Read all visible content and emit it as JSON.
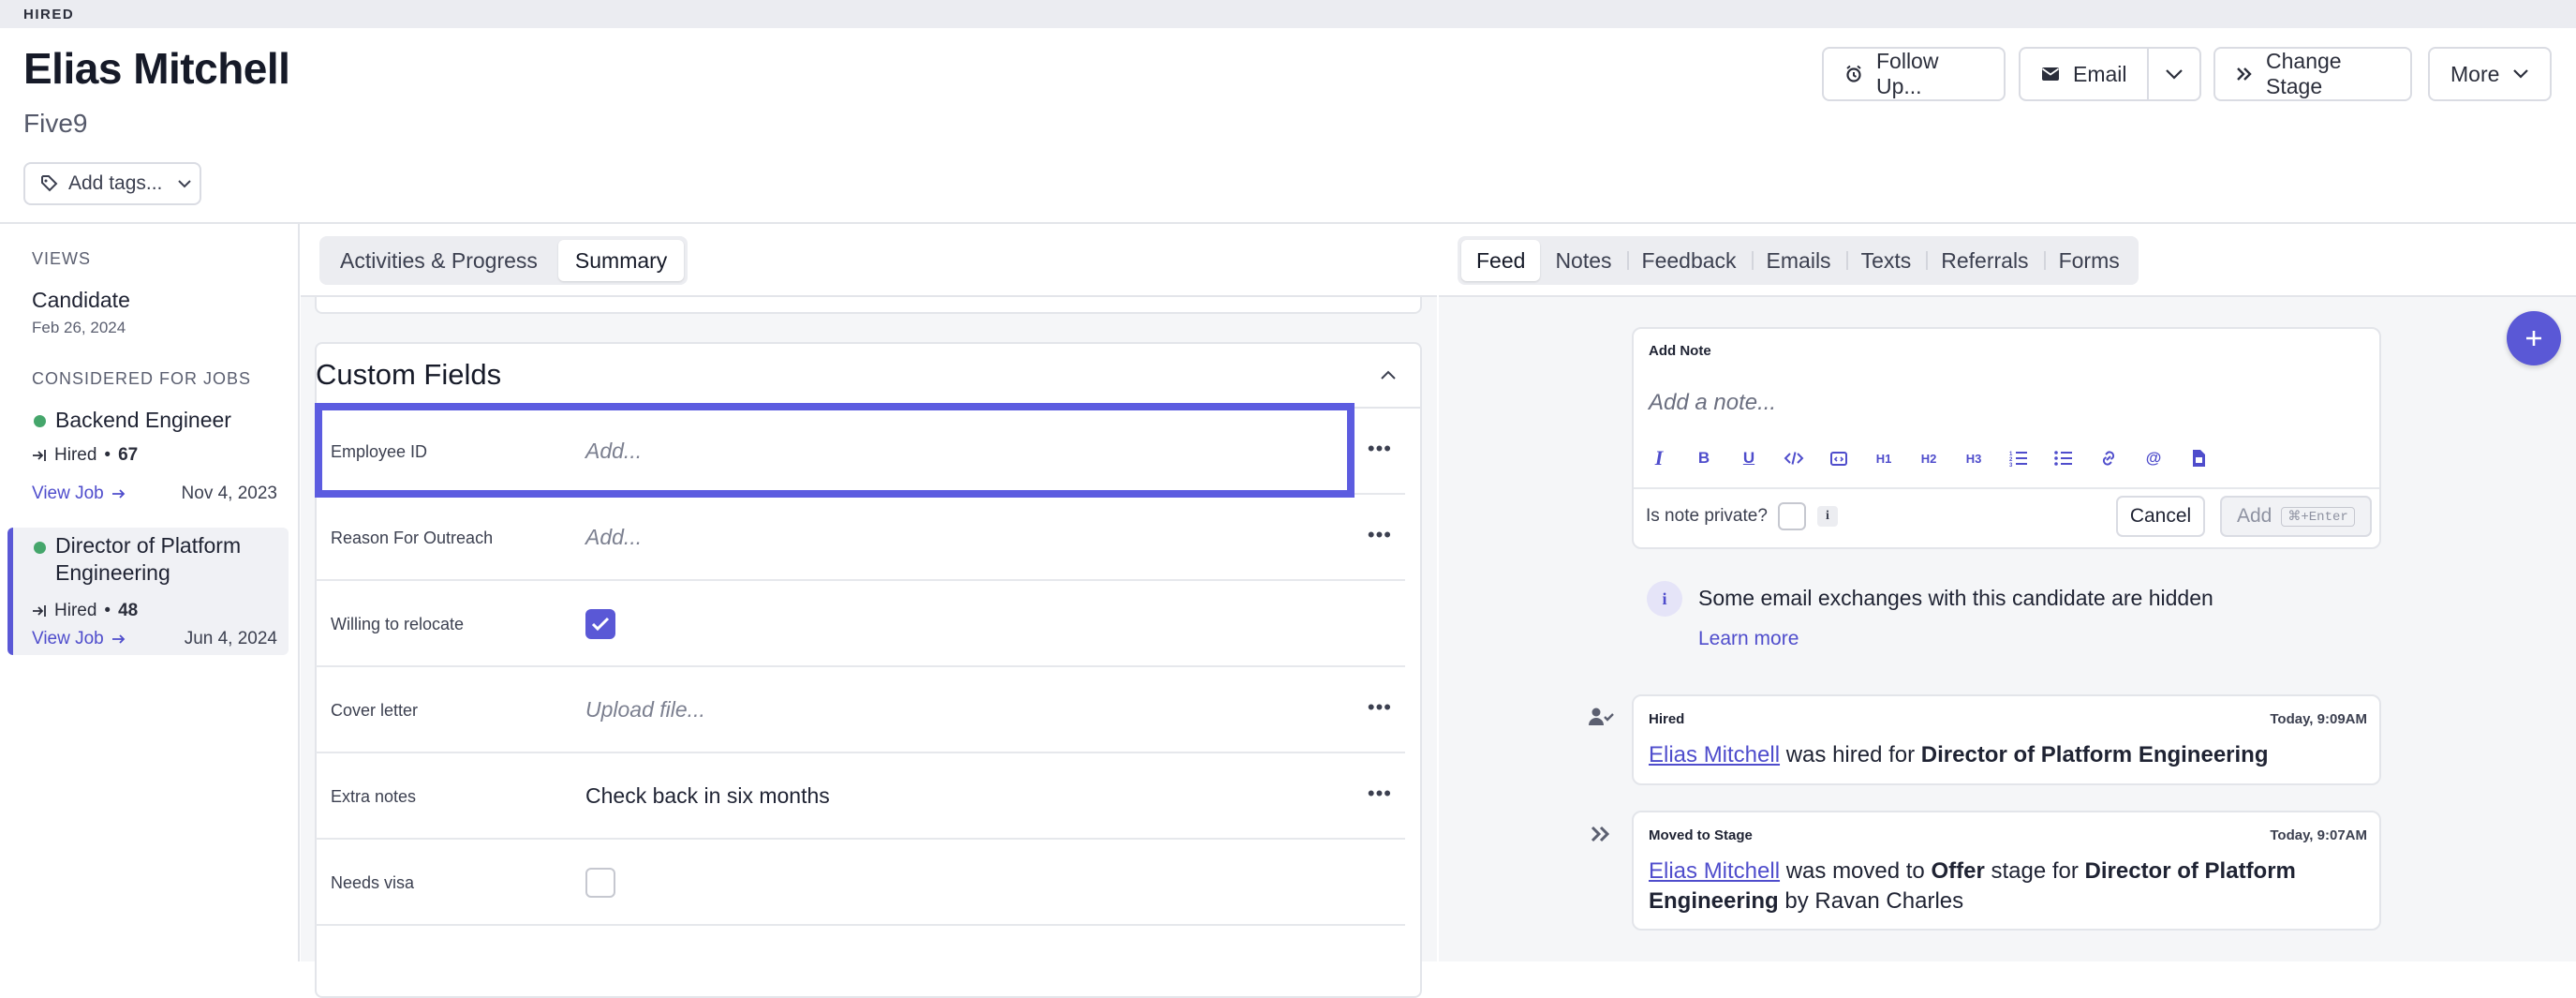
{
  "status_banner": "HIRED",
  "candidate": {
    "name": "Elias Mitchell",
    "company": "Five9"
  },
  "tags": {
    "label": "Add tags..."
  },
  "header_actions": {
    "follow_up": "Follow Up...",
    "email": "Email",
    "change_stage": "Change Stage",
    "more": "More"
  },
  "sidebar": {
    "views_label": "VIEWS",
    "view_title": "Candidate",
    "view_date": "Feb 26, 2024",
    "jobs_label": "CONSIDERED FOR JOBS",
    "jobs": [
      {
        "name": "Backend Engineer",
        "stage": "Hired",
        "count": "67",
        "view": "View Job",
        "date": "Nov 4, 2023"
      },
      {
        "name": "Director of Platform Engineering",
        "stage": "Hired",
        "count": "48",
        "view": "View Job",
        "date": "Jun 4, 2024"
      }
    ]
  },
  "middle": {
    "tabs": [
      "Activities & Progress",
      "Summary"
    ],
    "active_tab": "Summary",
    "card_title": "Custom Fields",
    "fields": [
      {
        "label": "Employee ID",
        "value": "Add...",
        "type": "text",
        "placeholder": true
      },
      {
        "label": "Reason For Outreach",
        "value": "Add...",
        "type": "text",
        "placeholder": true
      },
      {
        "label": "Willing to relocate",
        "value": "",
        "type": "checkbox",
        "checked": true
      },
      {
        "label": "Cover letter",
        "value": "Upload file...",
        "type": "file",
        "placeholder": true
      },
      {
        "label": "Extra notes",
        "value": "Check back in six months",
        "type": "text",
        "placeholder": false
      },
      {
        "label": "Needs visa",
        "value": "",
        "type": "checkbox",
        "checked": false
      }
    ]
  },
  "right": {
    "tabs": [
      "Feed",
      "Notes",
      "Feedback",
      "Emails",
      "Texts",
      "Referrals",
      "Forms"
    ],
    "active_tab": "Feed",
    "note": {
      "label": "Add Note",
      "placeholder": "Add a note...",
      "private_label": "Is note private?",
      "info": "i",
      "cancel": "Cancel",
      "add": "Add",
      "shortcut": "⌘+Enter",
      "toolbar": [
        "italic-icon",
        "bold-icon",
        "underline-icon",
        "code-icon",
        "code-block-icon",
        "h1-icon",
        "h2-icon",
        "h3-icon",
        "ordered-list-icon",
        "bullet-list-icon",
        "link-icon",
        "mention-icon",
        "attachment-icon"
      ]
    },
    "hidden_notice": {
      "text": "Some email exchanges with this candidate are hidden",
      "link": "Learn more"
    },
    "events": [
      {
        "type": "Hired",
        "time": "Today, 9:09AM",
        "person": "Elias Mitchell",
        "t1": " was hired for ",
        "job": "Director of Platform Engineering"
      },
      {
        "type": "Moved to Stage",
        "time": "Today, 9:07AM",
        "person": "Elias Mitchell",
        "t1": " was moved to ",
        "stage": "Offer",
        "t2": " stage for ",
        "job": "Director of Platform Engineering",
        "t3": " by ",
        "actor": "Ravan Charles"
      }
    ]
  },
  "colors": {
    "accent": "#5a58d6",
    "highlight": "#5c5ce0",
    "success": "#45a66b"
  }
}
